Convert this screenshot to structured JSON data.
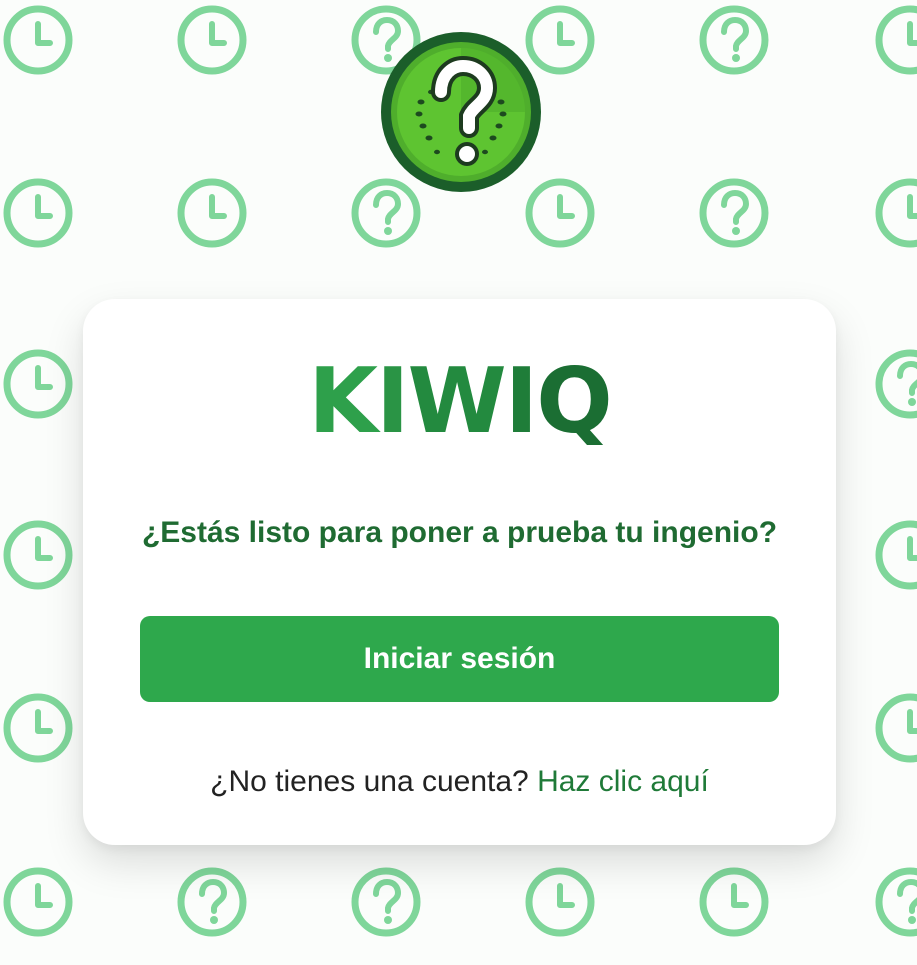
{
  "background": {
    "icon_color": "#7fd69a",
    "icons": [
      "clock-icon",
      "question-circle-icon"
    ]
  },
  "logo": {
    "icon": "kiwi-question-icon",
    "colors": {
      "ring": "#1b5e2a",
      "flesh": "#5cc130",
      "mark": "#ffffff"
    }
  },
  "card": {
    "brand": {
      "letters": [
        "K",
        "I",
        "W",
        "I",
        "Q"
      ]
    },
    "tagline": "¿Estás listo para poner a prueba tu ingenio?",
    "login_button_label": "Iniciar sesión",
    "signup_prompt": "¿No tienes una cuenta?",
    "signup_link": "Haz clic aquí"
  },
  "colors": {
    "primary": "#2ea84c",
    "dark_green": "#1f6b32",
    "text": "#222222"
  }
}
